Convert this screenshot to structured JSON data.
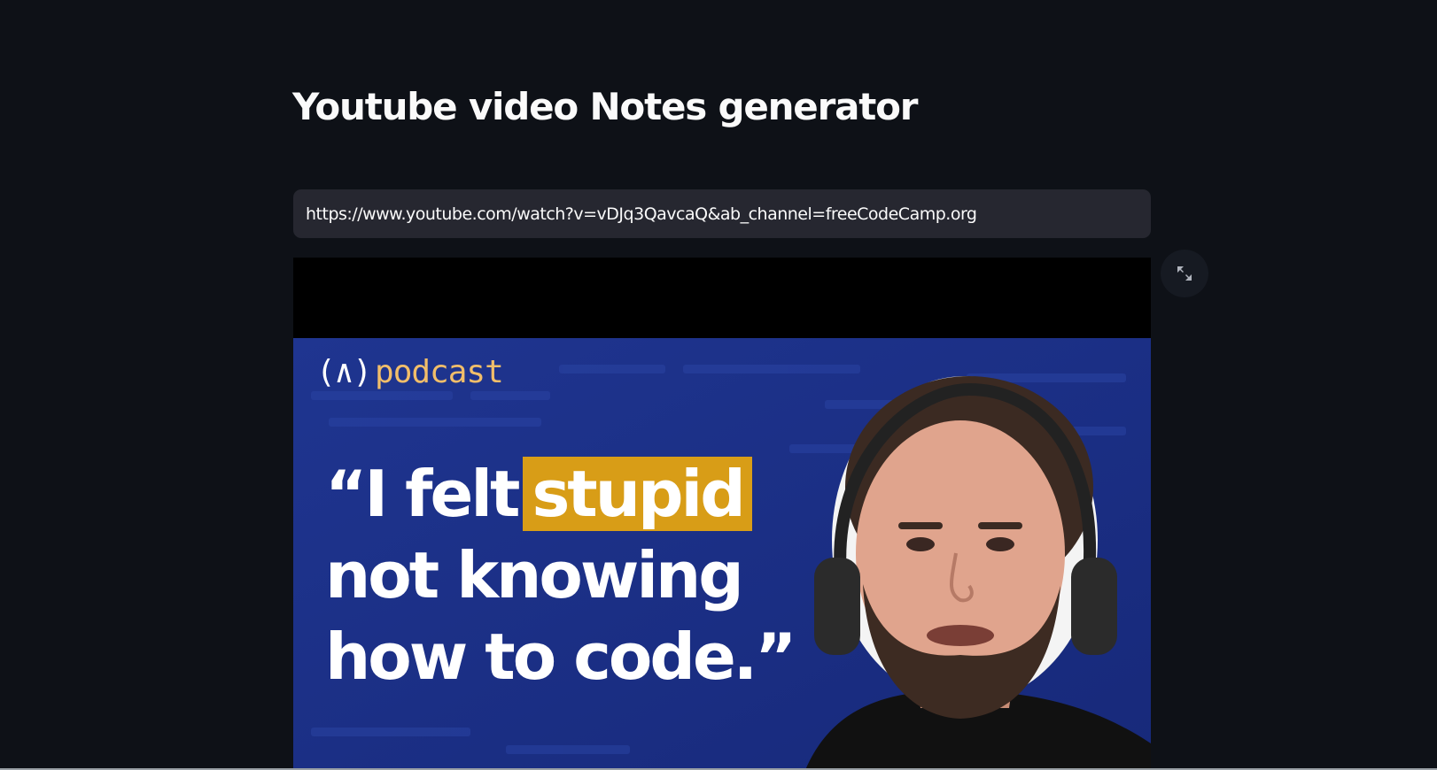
{
  "page": {
    "title": "Youtube video Notes generator"
  },
  "url_input": {
    "value": "https://www.youtube.com/watch?v=vDJq3QavcaQ&ab_channel=freeCodeCamp.org",
    "placeholder": ""
  },
  "video": {
    "thumbnail": {
      "logo_mark": "(∧)",
      "logo_text": "podcast",
      "quote_line1_prefix": "“I felt",
      "quote_highlight": "stupid",
      "quote_line2": "not knowing",
      "quote_line3": "how to code.”"
    }
  },
  "controls": {
    "fullscreen_icon": "expand-arrows-icon"
  },
  "colors": {
    "background": "#0e1117",
    "input_background": "#262730",
    "thumbnail_blue": "#1b2f8c",
    "highlight": "#d89d17",
    "logo_text": "#f1be6a"
  }
}
